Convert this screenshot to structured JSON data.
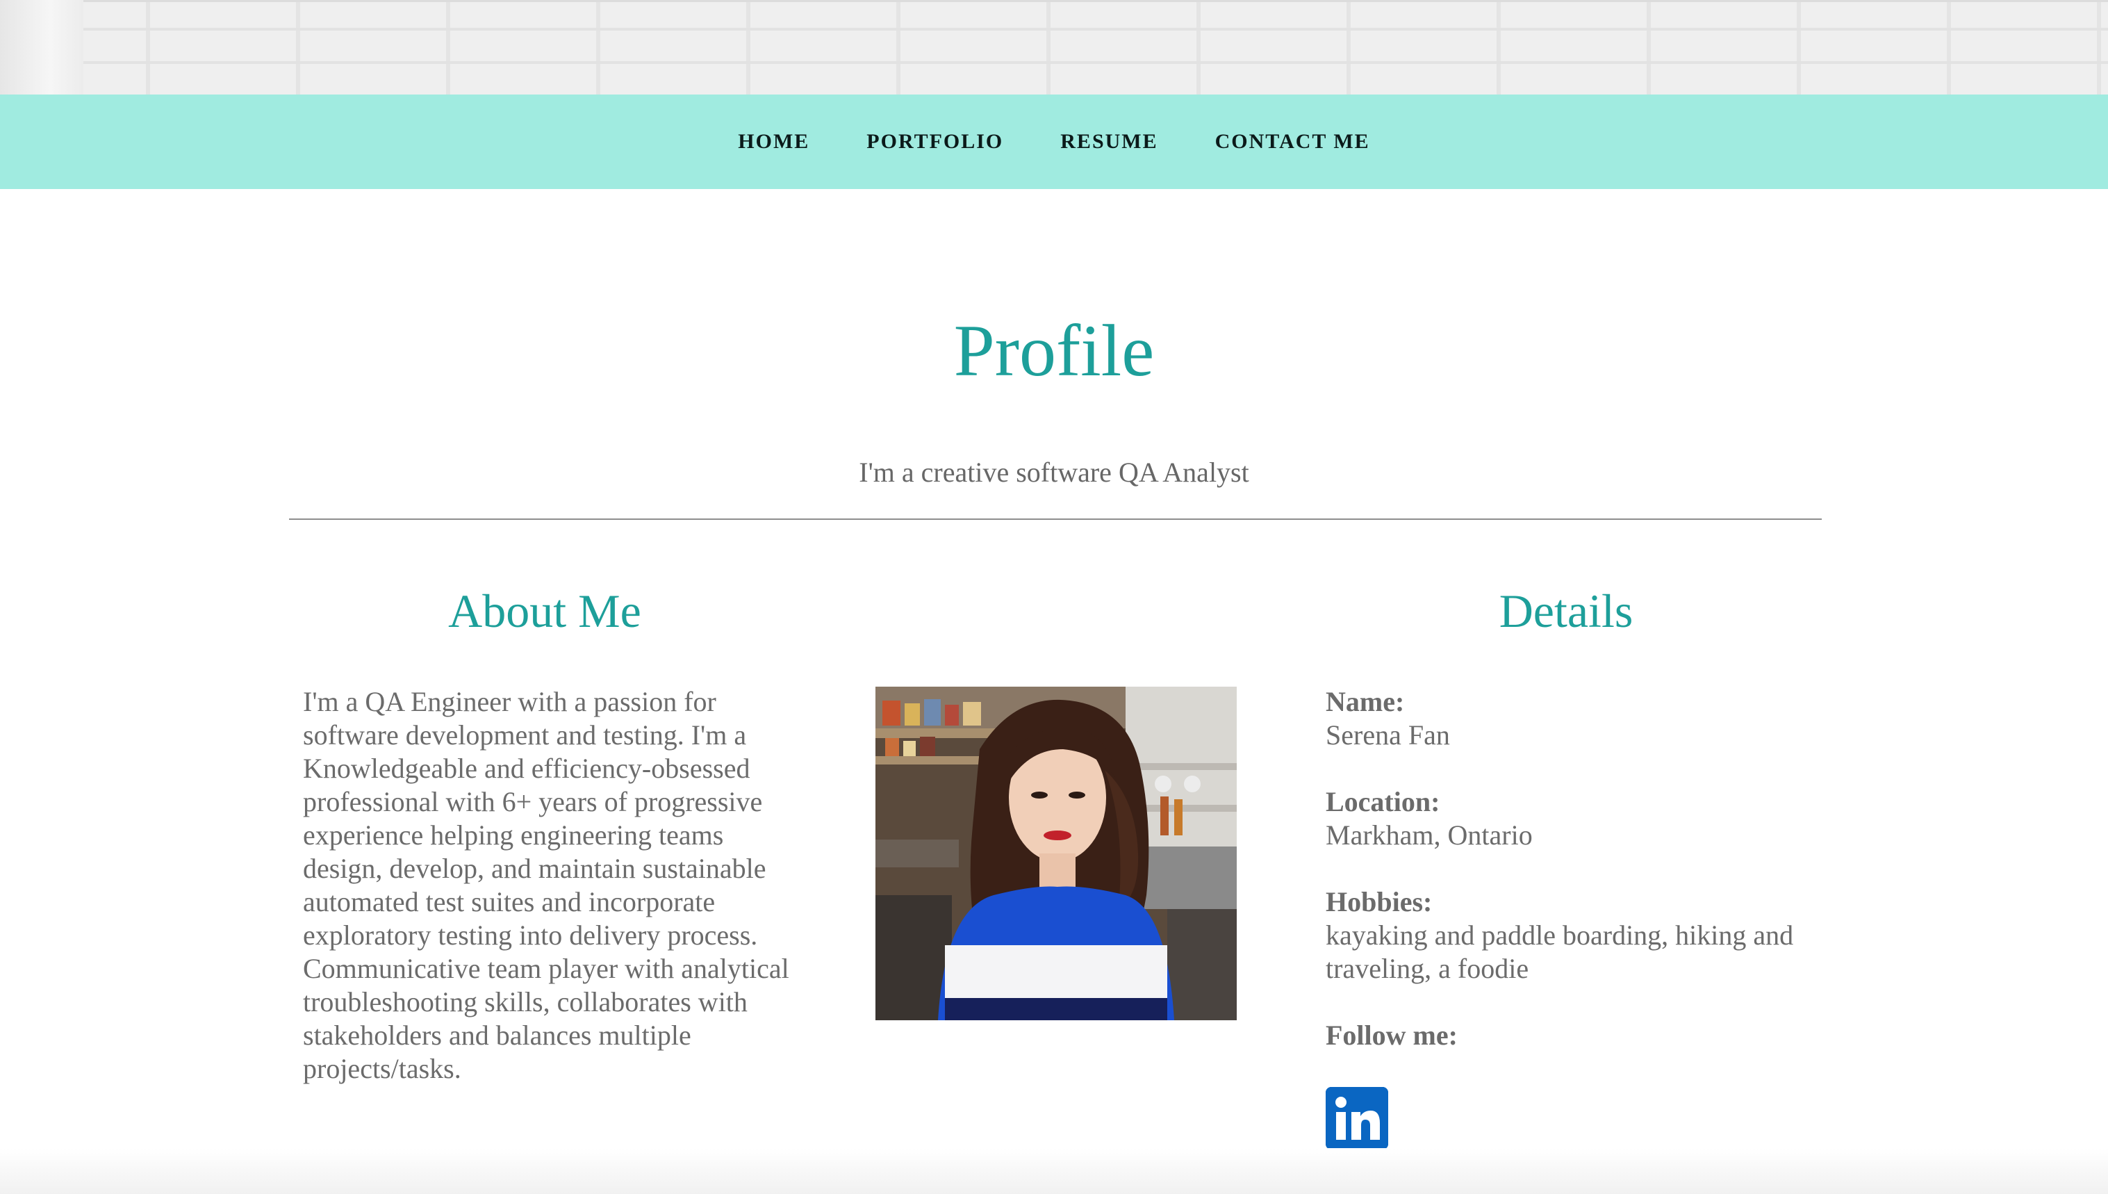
{
  "nav": {
    "items": [
      {
        "label": "HOME"
      },
      {
        "label": "PORTFOLIO"
      },
      {
        "label": "RESUME"
      },
      {
        "label": "CONTACT ME"
      }
    ]
  },
  "profile": {
    "title": "Profile",
    "subtitle": "I'm a creative software QA Analyst"
  },
  "about": {
    "heading": "About Me",
    "text": "I'm a QA Engineer with a passion for software development and testing. I'm a Knowledgeable and efficiency-obsessed professional with 6+ years of progressive experience helping engineering teams design, develop, and maintain sustainable automated test suites and incorporate exploratory testing into delivery process. Communicative team player with analytical troubleshooting skills, collaborates with stakeholders and balances multiple projects/tasks."
  },
  "details": {
    "heading": "Details",
    "name_label": "Name:",
    "name_value": "Serena Fan",
    "location_label": "Location:",
    "location_value": "Markham, Ontario",
    "hobbies_label": "Hobbies:",
    "hobbies_value": "kayaking and paddle boarding, hiking and traveling, a foodie",
    "follow_label": "Follow me:"
  },
  "icons": {
    "linkedin": "linkedin-icon"
  },
  "colors": {
    "nav_bg": "#a0ebe0",
    "accent": "#1d9f9a",
    "body_text": "#6b6b6b",
    "linkedin": "#0a66c2"
  }
}
